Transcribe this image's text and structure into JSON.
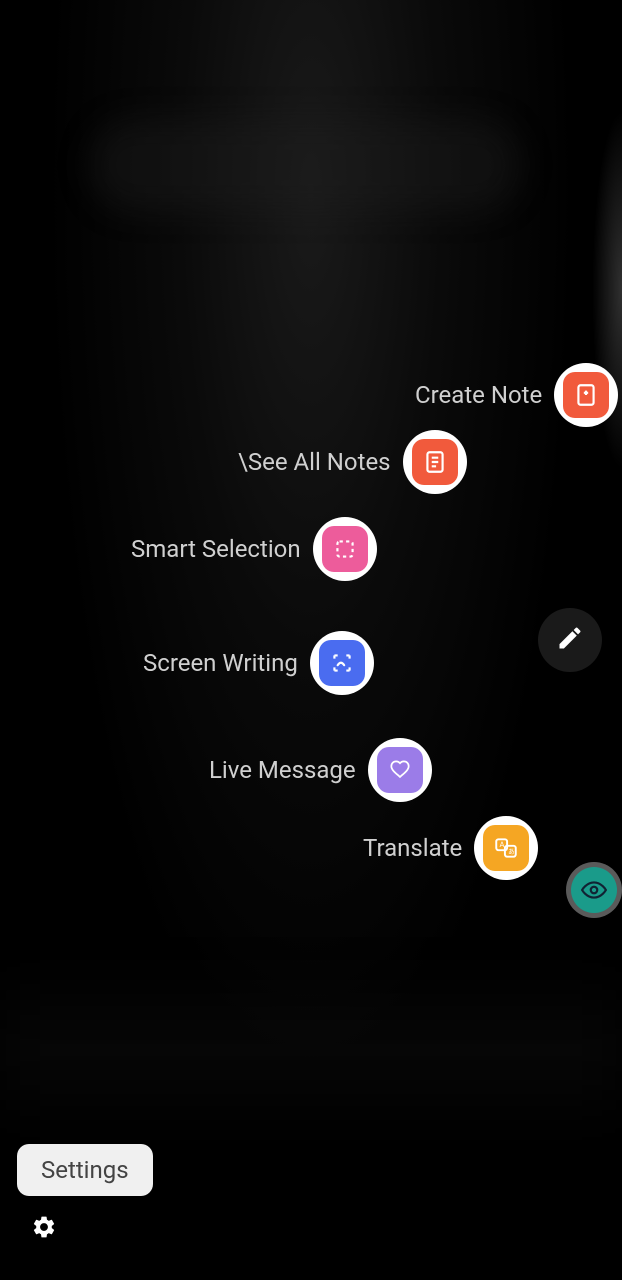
{
  "menu": {
    "create_note": {
      "label": "Create Note",
      "color": "#f15a3c"
    },
    "see_all_notes": {
      "label": "\\See All Notes",
      "color": "#f15a3c"
    },
    "smart_selection": {
      "label": "Smart Selection",
      "color": "#ed5c9b"
    },
    "screen_writing": {
      "label": "Screen Writing",
      "color": "#4a6cf0"
    },
    "live_message": {
      "label": "Live Message",
      "color": "#9b7ce8"
    },
    "translate": {
      "label": "Translate",
      "color": "#f5a623"
    }
  },
  "settings": {
    "label": "Settings"
  }
}
